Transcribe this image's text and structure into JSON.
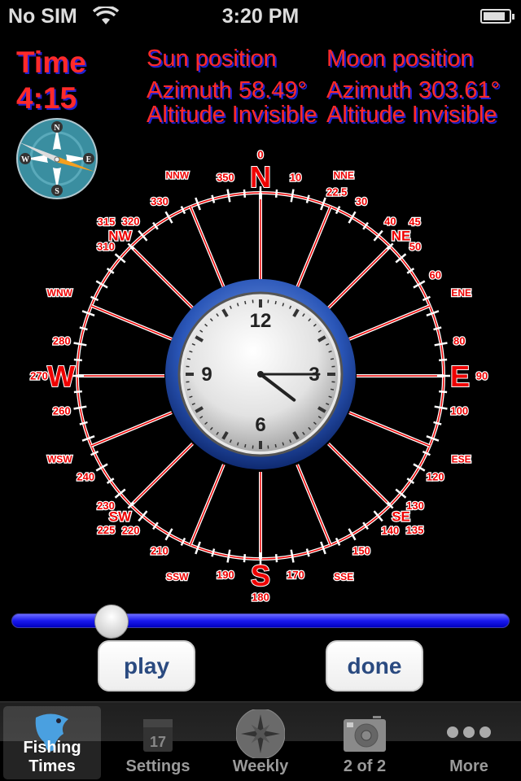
{
  "status_bar": {
    "carrier": "No SIM",
    "time": "3:20 PM",
    "battery_level": 0.85
  },
  "time_panel": {
    "label": "Time",
    "value": "4:15"
  },
  "sun": {
    "title": "Sun position",
    "azimuth": "Azimuth 58.49°",
    "altitude": "Altitude  Invisible"
  },
  "moon": {
    "title": "Moon position",
    "azimuth": "Azimuth 303.61°",
    "altitude": "Altitude  Invisible"
  },
  "mini_compass": {
    "letters": [
      "N",
      "E",
      "S",
      "W"
    ]
  },
  "rose": {
    "cardinals": [
      {
        "t": "N",
        "a": 0
      },
      {
        "t": "E",
        "a": 90
      },
      {
        "t": "S",
        "a": 180
      },
      {
        "t": "W",
        "a": 270
      }
    ],
    "cardinal_degrees": [
      {
        "t": "0",
        "a": 0
      },
      {
        "t": "90",
        "a": 90
      },
      {
        "t": "180",
        "a": 180
      },
      {
        "t": "270",
        "a": 270
      }
    ],
    "intercardinals": [
      {
        "t": "NE",
        "a": 45
      },
      {
        "t": "SE",
        "a": 135
      },
      {
        "t": "SW",
        "a": 225
      },
      {
        "t": "NW",
        "a": 315
      }
    ],
    "intercardinal_degrees": [
      {
        "t": "45",
        "a": 45
      },
      {
        "t": "135",
        "a": 135
      },
      {
        "t": "225",
        "a": 225
      },
      {
        "t": "315",
        "a": 315
      }
    ],
    "points": [
      {
        "t": "NNE",
        "a": 22.5
      },
      {
        "t": "ENE",
        "a": 67.5
      },
      {
        "t": "ESE",
        "a": 112.5
      },
      {
        "t": "SSE",
        "a": 157.5
      },
      {
        "t": "SSW",
        "a": 202.5
      },
      {
        "t": "WSW",
        "a": 247.5
      },
      {
        "t": "WNW",
        "a": 292.5
      },
      {
        "t": "NNW",
        "a": 337.5
      }
    ],
    "degrees": [
      "10",
      "22.5",
      "30",
      "40",
      "50",
      "60",
      "80",
      "100",
      "120",
      "130",
      "140",
      "150",
      "170",
      "190",
      "210",
      "220",
      "230",
      "240",
      "260",
      "280",
      "310",
      "320",
      "330",
      "350"
    ]
  },
  "clock": {
    "numerals": [
      "12",
      "3",
      "6",
      "9"
    ],
    "hour": 4,
    "minute": 15
  },
  "slider": {
    "value": 0.2
  },
  "buttons": {
    "play": "play",
    "done": "done"
  },
  "tabs": [
    {
      "label": "Fishing Times",
      "icon": "fish-icon",
      "selected": true
    },
    {
      "label": "Settings",
      "icon": "calendar-icon",
      "day": "17"
    },
    {
      "label": "Weekly",
      "icon": "compass-rose-icon"
    },
    {
      "label": "2 of 2",
      "icon": "camera-icon"
    },
    {
      "label": "More",
      "icon": "more-dots-icon"
    }
  ]
}
